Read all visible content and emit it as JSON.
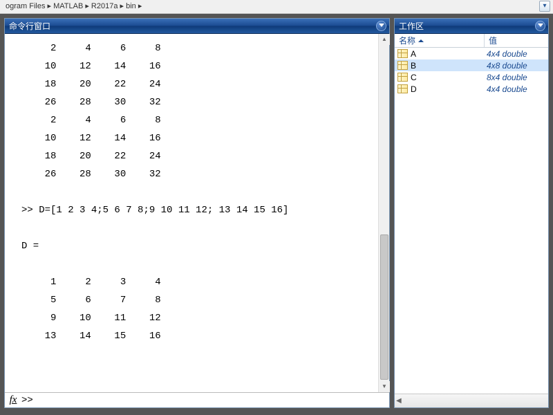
{
  "breadcrumb": "ogram Files  ▸  MATLAB  ▸  R2017a  ▸  bin  ▸",
  "panes": {
    "command_title": "命令行窗口",
    "workspace_title": "工作区"
  },
  "command_output": {
    "block1": [
      "     2     4     6     8",
      "    10    12    14    16",
      "    18    20    22    24",
      "    26    28    30    32",
      "     2     4     6     8",
      "    10    12    14    16",
      "    18    20    22    24",
      "    26    28    30    32"
    ],
    "input_line": ">> D=[1 2 3 4;5 6 7 8;9 10 11 12; 13 14 15 16]",
    "result_header": "D =",
    "block2": [
      "     1     2     3     4",
      "     5     6     7     8",
      "     9    10    11    12",
      "    13    14    15    16"
    ]
  },
  "fx_label": "fx",
  "prompt": ">>",
  "workspace": {
    "col_name": "名称",
    "col_value": "值",
    "vars": [
      {
        "name": "A",
        "value": "4x4 double"
      },
      {
        "name": "B",
        "value": "4x8 double"
      },
      {
        "name": "C",
        "value": "8x4 double"
      },
      {
        "name": "D",
        "value": "4x4 double"
      }
    ],
    "selected_index": 1
  }
}
